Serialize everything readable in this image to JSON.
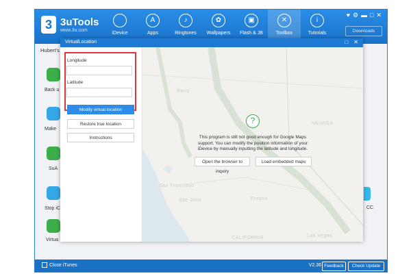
{
  "app": {
    "logo_glyph": "3",
    "name": "3uTools",
    "url": "www.3u.com",
    "nav": [
      {
        "label": "iDevice",
        "icon": "apple-icon",
        "glyph": ""
      },
      {
        "label": "Apps",
        "icon": "apps-icon",
        "glyph": "A"
      },
      {
        "label": "Ringtones",
        "icon": "bell-icon",
        "glyph": "♪"
      },
      {
        "label": "Wallpapers",
        "icon": "flower-icon",
        "glyph": "✿"
      },
      {
        "label": "Flash & JB",
        "icon": "box-icon",
        "glyph": "▣"
      },
      {
        "label": "Toolbox",
        "icon": "toolbox-icon",
        "glyph": "✕"
      },
      {
        "label": "Tutorials",
        "icon": "info-icon",
        "glyph": "i"
      }
    ],
    "window_controls": [
      "♥",
      "⚙",
      "▬",
      "□",
      "✕"
    ],
    "downloads_label": "Downloads",
    "device_name": "Hubert's",
    "background_apps": [
      {
        "label": "Back u"
      },
      {
        "label": "Make"
      },
      {
        "label": "SuA"
      },
      {
        "label": "Stop iC"
      },
      {
        "label": "Virtua"
      }
    ],
    "right_label": "CC",
    "footer": {
      "close_itunes": "Close iTunes",
      "version": "V2.36",
      "feedback": "Feedback",
      "check_update": "Check Update"
    }
  },
  "dialog": {
    "title": "VirtualLocation",
    "controls": [
      "□",
      "✕"
    ],
    "longitude_label": "Longitude",
    "longitude_value": "",
    "latitude_label": "Latitude",
    "latitude_value": "",
    "modify_btn": "Modify virtual location",
    "restore_btn": "Restore true location",
    "instructions_btn": "Instructions",
    "question_glyph": "?",
    "message": "This program is still not good enough for Google Maps support. You can modify the position information of your iDevice by manually inputting the latitude and longitude.",
    "open_browser_btn": "Open the browser to inquiry",
    "load_maps_btn": "Load embedded maps",
    "map_places": {
      "reno": "Reno",
      "nevada": "NEVADA",
      "sanfrancisco": "San Francisco",
      "sanjose": "San Jose",
      "california": "CALIFORNIA",
      "fresno": "Fresno",
      "lasvegas": "Las Vegas"
    }
  }
}
